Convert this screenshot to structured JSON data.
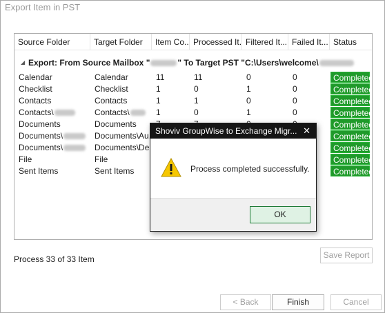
{
  "window": {
    "title": "Export Item in PST"
  },
  "columns": [
    "Source Folder",
    "Target Folder",
    "Item Co...",
    "Processed It...",
    "Filtered It...",
    "Failed It...",
    "Status"
  ],
  "group": {
    "prefix": "Export: From Source Mailbox \"",
    "middle": "\"  To Target PST \"C:\\Users\\welcome\\"
  },
  "rows": [
    {
      "source": "Calendar",
      "target": "Calendar",
      "count": "11",
      "processed": "11",
      "filtered": "0",
      "failed": "0",
      "status": "Completed"
    },
    {
      "source": "Checklist",
      "target": "Checklist",
      "count": "1",
      "processed": "0",
      "filtered": "1",
      "failed": "0",
      "status": "Completed"
    },
    {
      "source": "Contacts",
      "target": "Contacts",
      "count": "1",
      "processed": "1",
      "filtered": "0",
      "failed": "0",
      "status": "Completed"
    },
    {
      "source": "Contacts\\",
      "target": "Contacts\\",
      "count": "1",
      "processed": "0",
      "filtered": "1",
      "failed": "0",
      "status": "Completed"
    },
    {
      "source": "Documents",
      "target": "Documents",
      "count": "7",
      "processed": "7",
      "filtered": "0",
      "failed": "0",
      "status": "Completed"
    },
    {
      "source": "Documents\\",
      "target": "Documents\\Au...",
      "count": "",
      "processed": "",
      "filtered": "",
      "failed": "",
      "status": "Completed"
    },
    {
      "source": "Documents\\",
      "target": "Documents\\De...",
      "count": "",
      "processed": "",
      "filtered": "",
      "failed": "",
      "status": "Completed"
    },
    {
      "source": "File",
      "target": "File",
      "count": "",
      "processed": "",
      "filtered": "",
      "failed": "",
      "status": "Completed"
    },
    {
      "source": "Sent Items",
      "target": "Sent Items",
      "count": "",
      "processed": "",
      "filtered": "",
      "failed": "",
      "status": "Completed"
    }
  ],
  "progress": {
    "label": "Process 33 of 33 Item"
  },
  "buttons": {
    "save_report": "Save Report",
    "back": "< Back",
    "finish": "Finish",
    "cancel": "Cancel"
  },
  "dialog": {
    "title": "Shoviv GroupWise to Exchange Migr...",
    "close": "✕",
    "message": "Process completed successfully.",
    "ok": "OK",
    "icon": "warning-icon"
  },
  "colors": {
    "status_bg": "#1f9a2a",
    "dialog_title_bg": "#151515",
    "ok_bg": "#dff2e4",
    "ok_border": "#1e7a36"
  }
}
